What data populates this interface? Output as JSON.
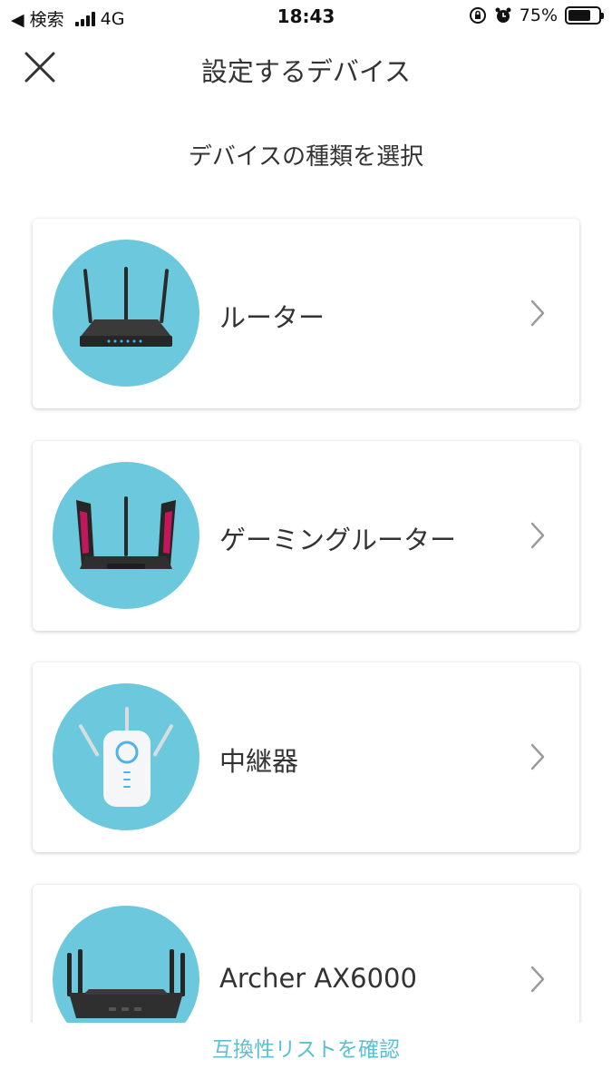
{
  "status_bar": {
    "back_label": "◀ 検索",
    "network": "4G",
    "time": "18:43",
    "battery": "75%",
    "battery_level": 0.75
  },
  "header": {
    "title": "設定するデバイス"
  },
  "subtitle": "デバイスの種類を選択",
  "devices": [
    {
      "label": "ルーター",
      "icon": "router-icon"
    },
    {
      "label": "ゲーミングルーター",
      "icon": "gaming-router-icon"
    },
    {
      "label": "中継器",
      "icon": "range-extender-icon"
    },
    {
      "label": "Archer AX6000",
      "icon": "archer-ax6000-icon"
    }
  ],
  "footer": {
    "link": "互換性リストを確認"
  },
  "colors": {
    "accent": "#5bc0d3",
    "icon_circle": "#6cc8dc"
  }
}
